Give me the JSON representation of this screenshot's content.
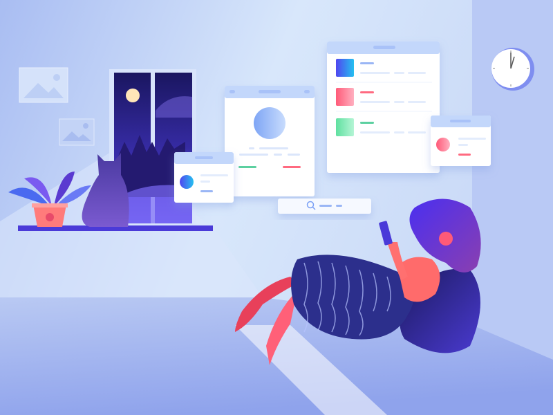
{
  "scene": {
    "description_free": true,
    "colors": {
      "wall": "#c9dcf8",
      "wall_right": "#b6c8f4",
      "floor": "#9fb2ee",
      "card": "#ffffff",
      "card_header": "#c3d7fb",
      "accent_blue": "#4f6bf5",
      "accent_red": "#ff5f7a",
      "accent_green": "#5be0a0",
      "purple": "#5b2fd6",
      "dress": "#2c2f8c",
      "skin": "#ff6b6b"
    },
    "icons": [
      "search-icon",
      "clock-icon",
      "picture-frame-icon"
    ]
  }
}
